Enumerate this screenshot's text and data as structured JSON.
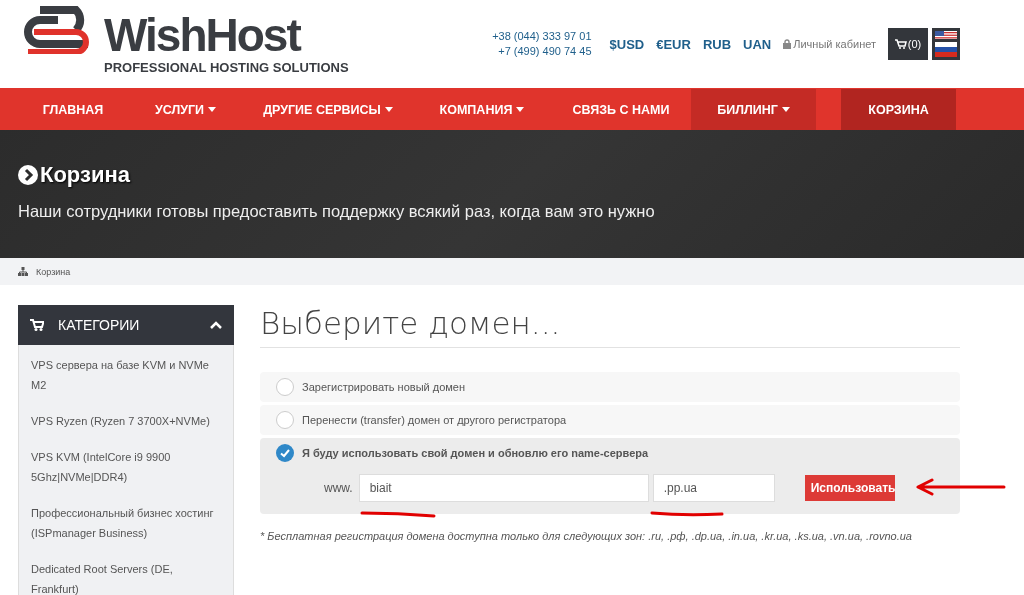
{
  "header": {
    "logo": {
      "name": "WishHost",
      "tagline": "PROFESSIONAL HOSTING SOLUTIONS"
    },
    "phones": [
      "+38 (044) 333 97 01",
      "+7 (499) 490 74 45"
    ],
    "currencies": [
      "$USD",
      "€EUR",
      "RUB",
      "UAN"
    ],
    "account": "Личный кабинет",
    "cart": "(0)"
  },
  "nav": [
    {
      "label": "ГЛАВНАЯ",
      "dropdown": false,
      "selected": false,
      "kind": "link"
    },
    {
      "label": "УСЛУГИ",
      "dropdown": true,
      "selected": false,
      "kind": "link"
    },
    {
      "label": "ДРУГИЕ СЕРВИСЫ",
      "dropdown": true,
      "selected": false,
      "kind": "link"
    },
    {
      "label": "КОМПАНИЯ",
      "dropdown": true,
      "selected": false,
      "kind": "link"
    },
    {
      "label": "СВЯЗЬ С НАМИ",
      "dropdown": false,
      "selected": false,
      "kind": "link"
    },
    {
      "label": "БИЛЛИНГ",
      "dropdown": true,
      "selected": true,
      "kind": "link"
    },
    {
      "label": "КОРЗИНА",
      "dropdown": false,
      "selected": false,
      "kind": "cart"
    }
  ],
  "hero": {
    "title": "Корзина",
    "subtitle": "Наши сотрудники готовы предоставить поддержку всякий раз, когда вам это нужно"
  },
  "breadcrumb": [
    "Корзина"
  ],
  "sidebar": {
    "title": "КАТЕГОРИИ",
    "expanded": true,
    "items": [
      "VPS сервера на базе KVM и NVMe M2",
      "VPS Ryzen (Ryzen 7 3700X+NVMe)",
      "VPS KVM (IntelCore i9 9900 5Ghz|NVMe|DDR4)",
      "Профессиональный бизнес хостинг (ISPmanager Business)",
      "Dedicated Root Servers (DE, Frankfurt)"
    ]
  },
  "main": {
    "heading": "Выберите домен...",
    "options": [
      {
        "label": "Зарегистрировать новый домен",
        "selected": false
      },
      {
        "label": "Перенести (transfer) домен от другого регистратора",
        "selected": false
      },
      {
        "label": "Я буду использовать свой домен и обновлю его name-сервера",
        "selected": true
      }
    ],
    "domain": {
      "prefix": "www.",
      "name": "biait",
      "tld": ".pp.ua",
      "button": "Использовать"
    },
    "note": "* Бесплатная регистрация домена доступна только для следующих зон: .ru, .рф, .dp.ua, .in.ua, .kr.ua, .ks.ua, .vn.ua, .rovno.ua"
  }
}
